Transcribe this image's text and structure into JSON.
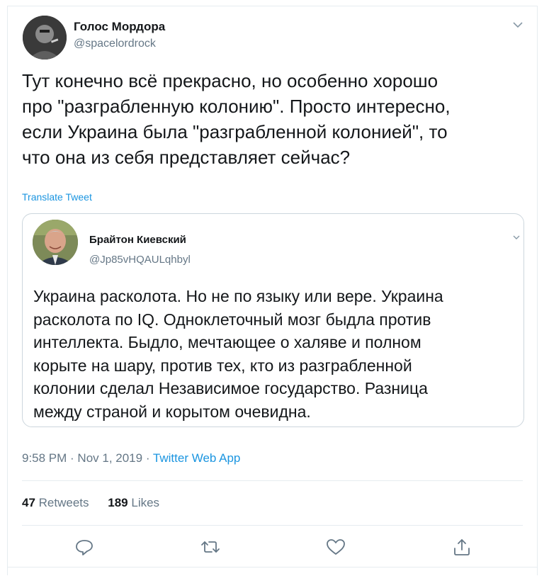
{
  "author": {
    "name": "Голос Мордора",
    "handle": "@spacelordrock"
  },
  "tweet": {
    "lines": [
      "Тут конечно всё прекрасно, но особенно хорошо",
      "про \"разграбленную колонию\". Просто интересно,",
      "если Украина была \"разграбленной колонией\", то",
      "что она из себя представляет сейчас?"
    ],
    "translate_label": "Translate Tweet"
  },
  "quote": {
    "name": "Брайтон Киевский",
    "handle": "@Jp85vHQAULqhbyl",
    "lines": [
      "Украина расколота. Но не по языку или вере. Украина",
      "расколота по IQ. Одноклеточный мозг быдла против",
      "интеллекта. Быдло, мечтающее о халяве и полном",
      "корыте на шару, против тех, кто из разграбленной",
      "колонии сделал Независимое государство. Разница",
      "между страной и корытом очевидна."
    ]
  },
  "meta": {
    "time": "9:58 PM",
    "sep1": " · ",
    "date": "Nov 1, 2019",
    "sep2": " · ",
    "source": "Twitter Web App"
  },
  "stats": {
    "retweets_count": "47",
    "retweets_label": "Retweets",
    "likes_count": "189",
    "likes_label": "Likes"
  },
  "actions": [
    "reply-icon",
    "retweet-icon",
    "like-icon",
    "share-icon"
  ],
  "colors": {
    "accent": "#1b95e0",
    "muted": "#657786",
    "text": "#14171a",
    "border": "#e6ecf0"
  }
}
